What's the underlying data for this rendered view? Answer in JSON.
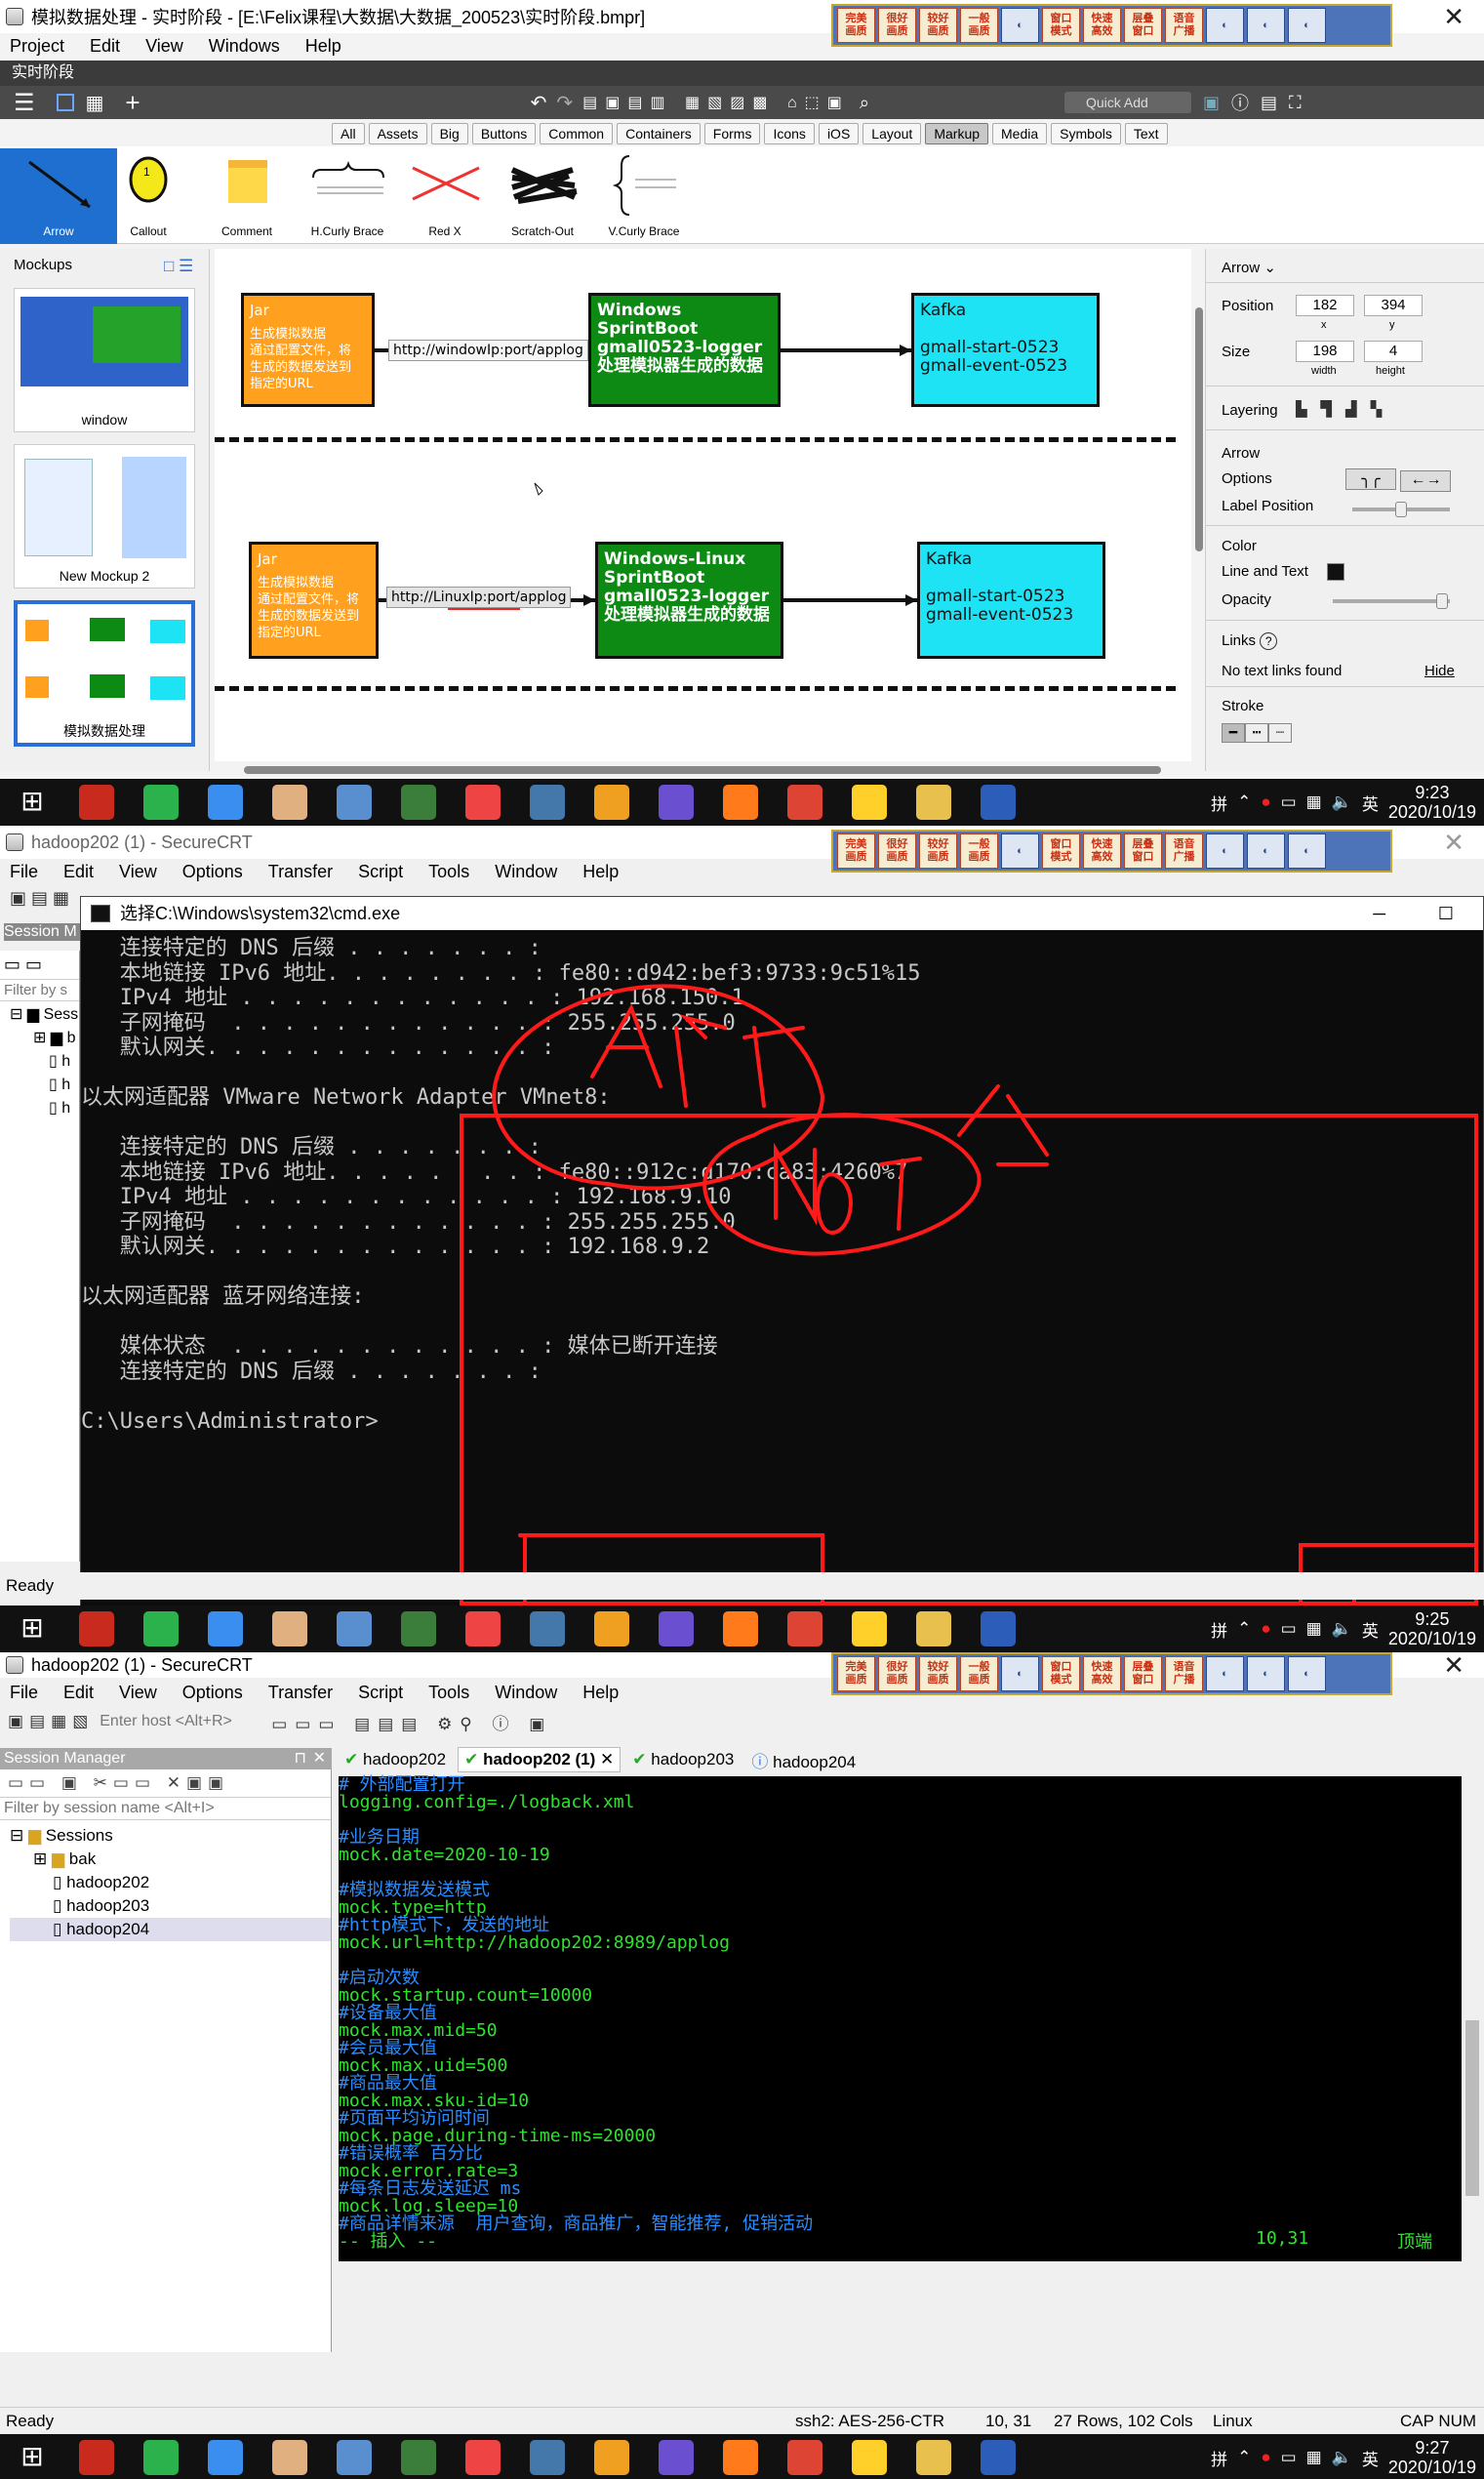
{
  "top": {
    "title": "模拟数据处理 - 实时阶段 - [E:\\Felix课程\\大数据\\大数据_200523\\实时阶段.bmpr]",
    "menu": [
      "Project",
      "Edit",
      "View",
      "Windows",
      "Help"
    ],
    "tab_label": "实时阶段",
    "quick_add": "Quick Add",
    "filter_tabs": [
      "All",
      "Assets",
      "Big",
      "Buttons",
      "Common",
      "Containers",
      "Forms",
      "Icons",
      "iOS",
      "Layout",
      "Markup",
      "Media",
      "Symbols",
      "Text"
    ],
    "active_filter": "Markup",
    "library": [
      "Arrow",
      "Callout",
      "Comment",
      "H.Curly Brace",
      "Red X",
      "Scratch-Out",
      "V.Curly Brace"
    ],
    "mockups_title": "Mockups",
    "mockups": [
      "window",
      "New Mockup 2",
      "模拟数据处理"
    ],
    "diagram": {
      "row1": {
        "jar_title": "Jar",
        "jar_text": "生成模拟数据\n通过配置文件，将\n生成的数据发送到\n指定的URL",
        "arrow_label": "http://windowIp:port/applog",
        "mid_text": "Windows\nSprintBoot\ngmall0523-logger\n处理模拟器生成的数据",
        "kafka_text": "Kafka\n\ngmall-start-0523\ngmall-event-0523"
      },
      "row2": {
        "jar_title": "Jar",
        "jar_text": "生成模拟数据\n通过配置文件，将\n生成的数据发送到\n指定的URL",
        "arrow_label": "http://LinuxIp:port/applog",
        "mid_text": "Windows-Linux\nSprintBoot\ngmall0523-logger\n处理模拟器生成的数据",
        "kafka_text": "Kafka\n\ngmall-start-0523\ngmall-event-0523"
      }
    },
    "props": {
      "header": "Arrow",
      "position_label": "Position",
      "x": "182",
      "y": "394",
      "x_lbl": "x",
      "y_lbl": "y",
      "size_label": "Size",
      "width": "198",
      "height": "4",
      "w_lbl": "width",
      "h_lbl": "height",
      "layering": "Layering",
      "arrow_options": "Arrow\nOptions",
      "label_position": "Label Position",
      "color": "Color",
      "line_text": "Line and Text",
      "opacity": "Opacity",
      "links": "Links",
      "no_links": "No text links found",
      "hide": "Hide",
      "stroke": "Stroke"
    },
    "clock_time": "9:23",
    "clock_date": "2020/10/19"
  },
  "ime": [
    "完美\n画质",
    "很好\n画质",
    "较好\n画质",
    "一般\n画质",
    "",
    "窗口\n模式",
    "快速\n高效",
    "层叠\n窗口",
    "语音\n广播",
    "",
    "",
    ""
  ],
  "middle": {
    "title": "hadoop202 (1) - SecureCRT",
    "menu": [
      "File",
      "Edit",
      "View",
      "Options",
      "Transfer",
      "Script",
      "Tools",
      "Window",
      "Help"
    ],
    "cmd_title": "选择C:\\Windows\\system32\\cmd.exe",
    "cmd_lines": [
      "   连接特定的 DNS 后缀 . . . . . . . :",
      "   本地链接 IPv6 地址. . . . . . . . : fe80::d942:bef3:9733:9c51%15",
      "   IPv4 地址 . . . . . . . . . . . . : 192.168.150.1",
      "   子网掩码  . . . . . . . . . . . . : 255.255.255.0",
      "   默认网关. . . . . . . . . . . . . :",
      "",
      "以太网适配器 VMware Network Adapter VMnet8:",
      "",
      "   连接特定的 DNS 后缀 . . . . . . . :",
      "   本地链接 IPv6 地址. . . . . . . . : fe80::912c:d170:ca83:4260%7",
      "   IPv4 地址 . . . . . . . . . . . . : 192.168.9.10",
      "   子网掩码  . . . . . . . . . . . . : 255.255.255.0",
      "   默认网关. . . . . . . . . . . . . : 192.168.9.2",
      "",
      "以太网适配器 蓝牙网络连接:",
      "",
      "   媒体状态  . . . . . . . . . . . . : 媒体已断开连接",
      "   连接特定的 DNS 后缀 . . . . . . . :",
      "",
      "C:\\Users\\Administrator>"
    ],
    "session_label": "Session M",
    "filter_label": "Filter by s",
    "tree_root": "Sess",
    "tree_items": [
      "b",
      "h",
      "h",
      "h"
    ],
    "status": "Ready",
    "clock_time": "9:25",
    "clock_date": "2020/10/19"
  },
  "bottom": {
    "title": "hadoop202 (1) - SecureCRT",
    "menu": [
      "File",
      "Edit",
      "View",
      "Options",
      "Transfer",
      "Script",
      "Tools",
      "Window",
      "Help"
    ],
    "host_placeholder": "Enter host <Alt+R>",
    "session_manager": "Session Manager",
    "filter_placeholder": "Filter by session name <Alt+I>",
    "sessions_root": "Sessions",
    "sessions": [
      "bak",
      "hadoop202",
      "hadoop203",
      "hadoop204"
    ],
    "tabs": [
      "hadoop202",
      "hadoop202 (1)",
      "hadoop203",
      "hadoop204"
    ],
    "active_tab": "hadoop202 (1)",
    "vim_lines": [
      {
        "t": "# 外部配置打开",
        "c": true
      },
      {
        "t": "logging.config=./logback.xml",
        "c": false
      },
      {
        "t": "",
        "c": false
      },
      {
        "t": "#业务日期",
        "c": true
      },
      {
        "t": "mock.date=2020-10-19",
        "c": false
      },
      {
        "t": "",
        "c": false
      },
      {
        "t": "#模拟数据发送模式",
        "c": true
      },
      {
        "t": "mock.type=http",
        "c": false
      },
      {
        "t": "#http模式下，发送的地址",
        "c": true
      },
      {
        "t": "mock.url=http://hadoop202:8989/applog",
        "c": false
      },
      {
        "t": "",
        "c": false
      },
      {
        "t": "#启动次数",
        "c": true
      },
      {
        "t": "mock.startup.count=10000",
        "c": false
      },
      {
        "t": "#设备最大值",
        "c": true
      },
      {
        "t": "mock.max.mid=50",
        "c": false
      },
      {
        "t": "#会员最大值",
        "c": true
      },
      {
        "t": "mock.max.uid=500",
        "c": false
      },
      {
        "t": "#商品最大值",
        "c": true
      },
      {
        "t": "mock.max.sku-id=10",
        "c": false
      },
      {
        "t": "#页面平均访问时间",
        "c": true
      },
      {
        "t": "mock.page.during-time-ms=20000",
        "c": false
      },
      {
        "t": "#错误概率 百分比",
        "c": true
      },
      {
        "t": "mock.error.rate=3",
        "c": false
      },
      {
        "t": "#每条日志发送延迟 ms",
        "c": true
      },
      {
        "t": "mock.log.sleep=10",
        "c": false
      },
      {
        "t": "#商品详情来源  用户查询，商品推广，智能推荐, 促销活动",
        "c": true
      },
      {
        "t": "-- 插入 --",
        "c": false
      }
    ],
    "cursor_pos": "10,31",
    "vim_pos": "顶端",
    "status_ready": "Ready",
    "status_cipher": "ssh2: AES-256-CTR",
    "status_rc": "10,  31",
    "status_size": "27 Rows, 102 Cols",
    "status_os": "Linux",
    "status_keys": "CAP  NUM",
    "clock_time": "9:27",
    "clock_date": "2020/10/19"
  },
  "taskbar_icons": [
    "windows-start-icon",
    "game-icon",
    "wechat-icon",
    "baidu-netdisk-icon",
    "avatar-icon",
    "screen-icon",
    "green-icon",
    "balsamiq-icon",
    "capture-icon",
    "explorer-icon",
    "idea-icon",
    "firefox-icon",
    "chrome-icon",
    "face-icon",
    "folder-icon",
    "word-icon"
  ],
  "colors": {
    "jar": "#ffa11f",
    "server": "#0d8a13",
    "kafka": "#1de3f5",
    "annotation": "#ff1a1a",
    "terminal_green": "#2fe22f",
    "terminal_comment": "#2a8cff"
  }
}
